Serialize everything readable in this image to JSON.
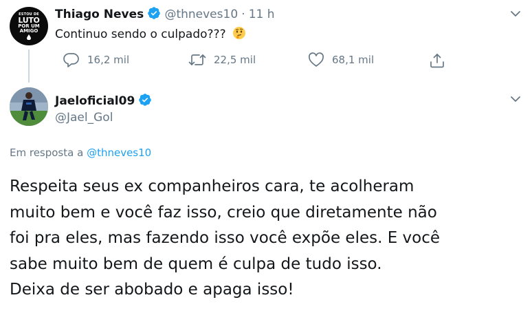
{
  "tweet1": {
    "avatar_text": [
      "ESTOU DE",
      "LUTO",
      "POR UM",
      "AMIGO"
    ],
    "name": "Thiago Neves",
    "handle": "@thneves10",
    "separator": "·",
    "time": "11 h",
    "text": "Continuo sendo o culpado???",
    "emoji": "thinking-face",
    "replies": "16,2 mil",
    "retweets": "22,5 mil",
    "likes": "68,1 mil"
  },
  "tweet2": {
    "name": "Jaeloficial09",
    "handle": "@Jael_Gol",
    "reply_prefix": "Em resposta a",
    "reply_handle": "@thneves10",
    "lines": [
      "Respeita seus ex companheiros cara, te acolheram",
      "muito bem e você faz isso, creio que diretamente não",
      "foi pra eles, mas fazendo isso você expõe eles. E você",
      "sabe muito bem de quem é culpa de tudo isso.",
      "Deixa de ser abobado e apaga isso!"
    ]
  },
  "colors": {
    "text": "#14171a",
    "secondary": "#657786",
    "accent": "#1da1f2",
    "line": "#ccd6dd"
  }
}
